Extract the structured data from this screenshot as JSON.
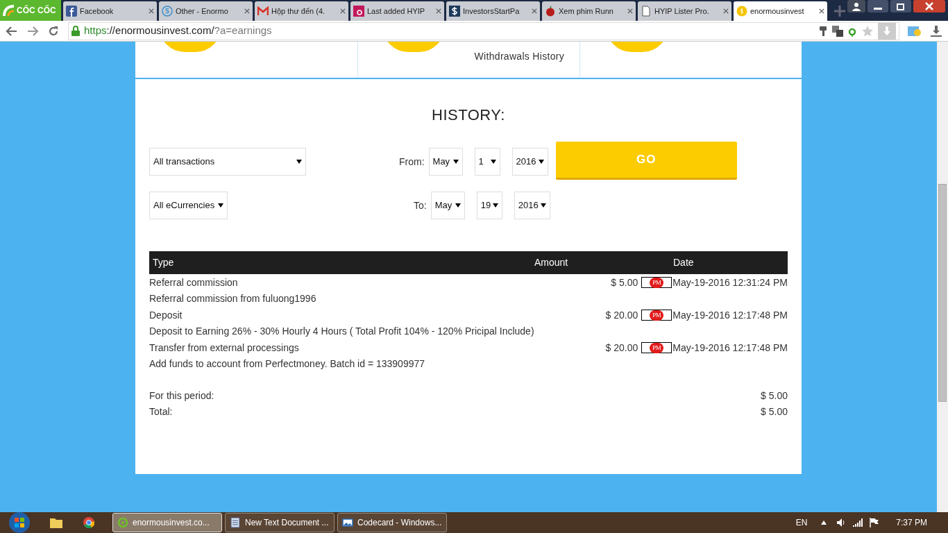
{
  "browser": {
    "logo": "CỐC CỐC",
    "tabs": [
      {
        "title": "Facebook",
        "kind": "facebook",
        "selected": false
      },
      {
        "title": "Other - Enormo",
        "kind": "coin",
        "selected": false
      },
      {
        "title": "Hộp thư đến (4.",
        "kind": "mail",
        "selected": false
      },
      {
        "title": "Last added HYIP",
        "kind": "letter",
        "selected": false
      },
      {
        "title": "InvestorsStartPa",
        "kind": "dollar",
        "selected": false
      },
      {
        "title": "Xem phim Runn",
        "kind": "apple",
        "selected": false
      },
      {
        "title": "HYIP Lister Pro.",
        "kind": "page",
        "selected": false
      },
      {
        "title": "enormousinvest",
        "kind": "coin-yellow",
        "selected": true
      }
    ],
    "url": {
      "scheme": "https",
      "host": "://enormousinvest.com/",
      "path": "?a=earnings"
    }
  },
  "withdrawals_link": "Withdrawals History",
  "history": {
    "title": "HISTORY:",
    "type_select": "All transactions",
    "currency_select": "All eCurrencies",
    "from_label": "From:",
    "from": [
      "May",
      "1",
      "2016"
    ],
    "to_label": "To:",
    "to": [
      "May",
      "19",
      "2016"
    ],
    "go_button": "GO",
    "table": {
      "columns": [
        "Type",
        "Amount",
        "Date"
      ],
      "rows": [
        {
          "type": "Referral commission",
          "amount": "$ 5.00",
          "processor": "PM",
          "date": "May-19-2016 12:31:24 PM",
          "detail": "Referral commission from fuluong1996"
        },
        {
          "type": "Deposit",
          "amount": "$ 20.00",
          "processor": "PM",
          "date": "May-19-2016 12:17:48 PM",
          "detail": "Deposit to Earning 26% - 30% Hourly 4 Hours ( Total Profit 104% - 120% Pricipal Include)"
        },
        {
          "type": "Transfer from external processings",
          "amount": "$ 20.00",
          "processor": "PM",
          "date": "May-19-2016 12:17:48 PM",
          "detail": "Add funds to account from Perfectmoney. Batch id = 133909977"
        }
      ]
    },
    "totals": [
      {
        "label": "For this period:",
        "value": "$ 5.00"
      },
      {
        "label": "Total:",
        "value": "$ 5.00"
      }
    ]
  },
  "taskbar": {
    "windows": [
      {
        "title": "enormousinvest.co...",
        "kind": "browser",
        "selected": true
      },
      {
        "title": "New Text Document ...",
        "kind": "notepad",
        "selected": false
      },
      {
        "title": "Codecard - Windows...",
        "kind": "picture-viewer",
        "selected": false
      }
    ],
    "language": "EN",
    "clock": "7:37 PM"
  }
}
